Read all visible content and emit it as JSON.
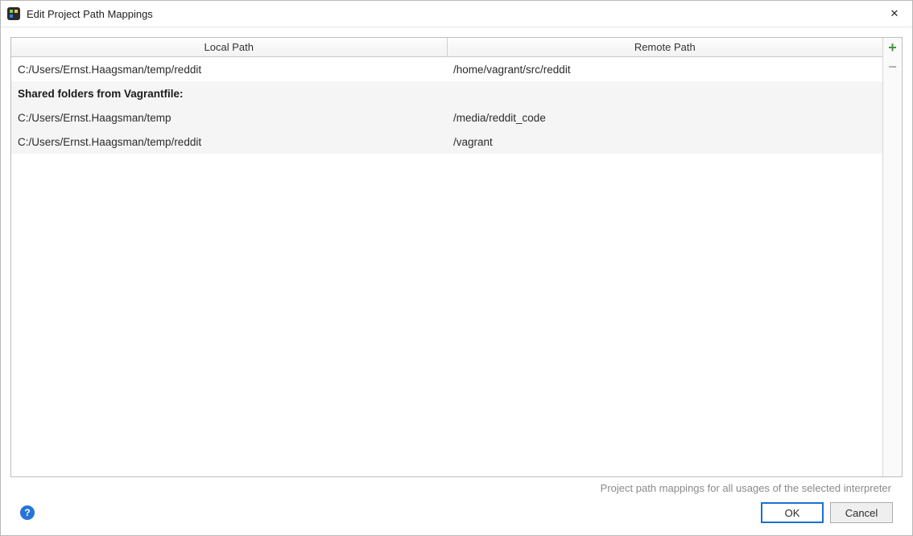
{
  "window": {
    "title": "Edit Project Path Mappings"
  },
  "table": {
    "columns": {
      "local": "Local Path",
      "remote": "Remote Path"
    },
    "rows": [
      {
        "local": "C:/Users/Ernst.Haagsman/temp/reddit",
        "remote": "/home/vagrant/src/reddit"
      }
    ],
    "shared_section_label": "Shared folders from Vagrantfile:",
    "shared_rows": [
      {
        "local": "C:/Users/Ernst.Haagsman/temp",
        "remote": "/media/reddit_code"
      },
      {
        "local": "C:/Users/Ernst.Haagsman/temp/reddit",
        "remote": "/vagrant"
      }
    ]
  },
  "hint": "Project path mappings for all usages of the selected interpreter",
  "buttons": {
    "ok": "OK",
    "cancel": "Cancel"
  },
  "icons": {
    "add": "+",
    "remove": "−",
    "help": "?",
    "close": "✕"
  }
}
